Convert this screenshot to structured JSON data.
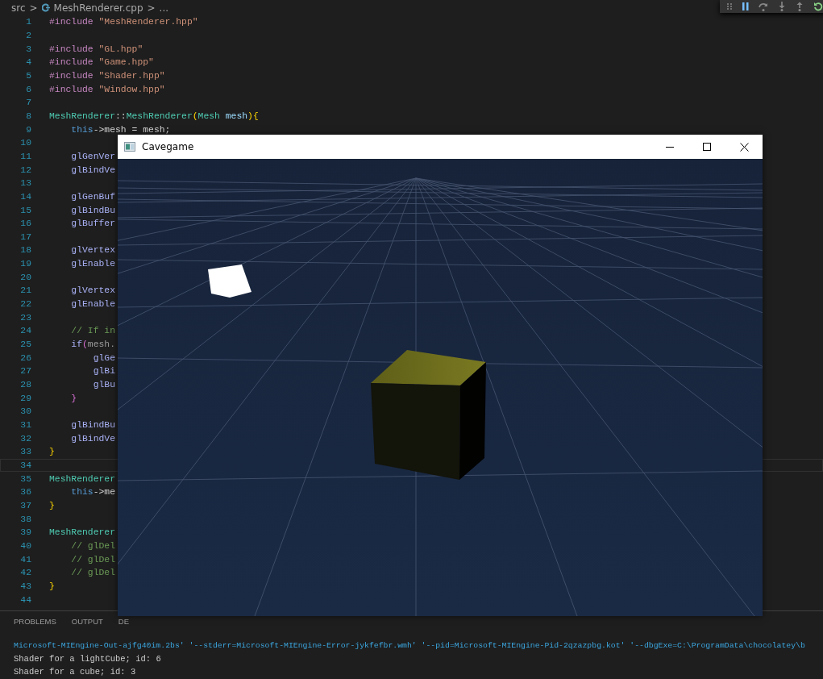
{
  "breadcrumb": {
    "folder": "src",
    "separator_1": ">",
    "file": "MeshRenderer.cpp",
    "separator_2": ">",
    "more": "..."
  },
  "debug_toolbar": {
    "buttons": [
      {
        "kind": "grip"
      },
      {
        "kind": "pause"
      },
      {
        "kind": "step-over"
      },
      {
        "kind": "step-into"
      },
      {
        "kind": "step-out"
      },
      {
        "kind": "restart"
      }
    ]
  },
  "editor": {
    "lines": [
      {
        "number": "1",
        "current": false,
        "tokens": [
          {
            "kind": "directive",
            "text": "#include "
          },
          {
            "kind": "string",
            "text": "\"MeshRenderer.hpp\""
          }
        ]
      },
      {
        "number": "2",
        "current": false
      },
      {
        "number": "3",
        "current": false,
        "tokens": [
          {
            "kind": "directive",
            "text": "#include "
          },
          {
            "kind": "string",
            "text": "\"GL.hpp\""
          }
        ]
      },
      {
        "number": "4",
        "current": false,
        "tokens": [
          {
            "kind": "directive",
            "text": "#include "
          },
          {
            "kind": "string",
            "text": "\"Game.hpp\""
          }
        ]
      },
      {
        "number": "5",
        "current": false,
        "tokens": [
          {
            "kind": "directive",
            "text": "#include "
          },
          {
            "kind": "string",
            "text": "\"Shader.hpp\""
          }
        ]
      },
      {
        "number": "6",
        "current": false,
        "tokens": [
          {
            "kind": "directive",
            "text": "#include "
          },
          {
            "kind": "string",
            "text": "\"Window.hpp\""
          }
        ]
      },
      {
        "number": "7",
        "current": false
      },
      {
        "number": "8",
        "current": false,
        "tokens": [
          {
            "kind": "type",
            "text": "MeshRenderer"
          },
          {
            "kind": "plain",
            "text": "::"
          },
          {
            "kind": "type",
            "text": "MeshRenderer"
          },
          {
            "kind": "bracket",
            "text": "("
          },
          {
            "kind": "type",
            "text": "Mesh"
          },
          {
            "kind": "variable",
            "text": " mesh"
          },
          {
            "kind": "bracket",
            "text": ")"
          },
          {
            "kind": "bracket",
            "text": "{"
          }
        ]
      },
      {
        "number": "9",
        "current": false,
        "tokens": [
          {
            "kind": "keyword",
            "text": "    this"
          },
          {
            "kind": "plain",
            "text": "->mesh = mesh;"
          }
        ]
      },
      {
        "number": "10",
        "current": false
      },
      {
        "number": "11",
        "current": false,
        "tokens": [
          {
            "kind": "function",
            "text": "    glGenVer"
          }
        ]
      },
      {
        "number": "12",
        "current": false,
        "tokens": [
          {
            "kind": "function",
            "text": "    glBindVe"
          }
        ]
      },
      {
        "number": "13",
        "current": false
      },
      {
        "number": "14",
        "current": false,
        "tokens": [
          {
            "kind": "function",
            "text": "    glGenBuf"
          }
        ]
      },
      {
        "number": "15",
        "current": false,
        "tokens": [
          {
            "kind": "function",
            "text": "    glBindBu"
          }
        ]
      },
      {
        "number": "16",
        "current": false,
        "tokens": [
          {
            "kind": "function",
            "text": "    glBuffer"
          }
        ]
      },
      {
        "number": "17",
        "current": false
      },
      {
        "number": "18",
        "current": false,
        "tokens": [
          {
            "kind": "function",
            "text": "    glVertex"
          }
        ]
      },
      {
        "number": "19",
        "current": false,
        "tokens": [
          {
            "kind": "function",
            "text": "    glEnable"
          }
        ]
      },
      {
        "number": "20",
        "current": false
      },
      {
        "number": "21",
        "current": false,
        "tokens": [
          {
            "kind": "function",
            "text": "    glVertex"
          }
        ]
      },
      {
        "number": "22",
        "current": false,
        "tokens": [
          {
            "kind": "function",
            "text": "    glEnable"
          }
        ]
      },
      {
        "number": "23",
        "current": false
      },
      {
        "number": "24",
        "current": false,
        "tokens": [
          {
            "kind": "comment",
            "text": "    // If in"
          }
        ]
      },
      {
        "number": "25",
        "current": false,
        "tokens": [
          {
            "kind": "function",
            "text": "    if"
          },
          {
            "kind": "bracket2",
            "text": "("
          },
          {
            "kind": "muted",
            "text": "mesh."
          }
        ]
      },
      {
        "number": "26",
        "current": false,
        "tokens": [
          {
            "kind": "function",
            "text": "        glGe"
          }
        ]
      },
      {
        "number": "27",
        "current": false,
        "tokens": [
          {
            "kind": "function",
            "text": "        glBi"
          }
        ]
      },
      {
        "number": "28",
        "current": false,
        "tokens": [
          {
            "kind": "function",
            "text": "        glBu"
          }
        ]
      },
      {
        "number": "29",
        "current": false,
        "tokens": [
          {
            "kind": "bracket2",
            "text": "    }"
          }
        ]
      },
      {
        "number": "30",
        "current": false
      },
      {
        "number": "31",
        "current": false,
        "tokens": [
          {
            "kind": "function",
            "text": "    glBindBu"
          }
        ]
      },
      {
        "number": "32",
        "current": false,
        "tokens": [
          {
            "kind": "function",
            "text": "    glBindVe"
          }
        ]
      },
      {
        "number": "33",
        "current": false,
        "tokens": [
          {
            "kind": "bracket",
            "text": "}"
          }
        ]
      },
      {
        "number": "34",
        "current": true
      },
      {
        "number": "35",
        "current": false,
        "tokens": [
          {
            "kind": "type",
            "text": "MeshRenderer"
          }
        ]
      },
      {
        "number": "36",
        "current": false,
        "tokens": [
          {
            "kind": "keyword",
            "text": "    this"
          },
          {
            "kind": "plain",
            "text": "->me"
          }
        ]
      },
      {
        "number": "37",
        "current": false,
        "tokens": [
          {
            "kind": "bracket",
            "text": "}"
          }
        ]
      },
      {
        "number": "38",
        "current": false
      },
      {
        "number": "39",
        "current": false,
        "tokens": [
          {
            "kind": "type",
            "text": "MeshRenderer"
          }
        ]
      },
      {
        "number": "40",
        "current": false,
        "tokens": [
          {
            "kind": "comment",
            "text": "    // glDel"
          }
        ]
      },
      {
        "number": "41",
        "current": false,
        "tokens": [
          {
            "kind": "comment",
            "text": "    // glDel"
          }
        ]
      },
      {
        "number": "42",
        "current": false,
        "tokens": [
          {
            "kind": "comment",
            "text": "    // glDel"
          }
        ]
      },
      {
        "number": "43",
        "current": false,
        "tokens": [
          {
            "kind": "bracket",
            "text": "}"
          }
        ]
      },
      {
        "number": "44",
        "current": false
      }
    ]
  },
  "panel": {
    "tabs": [
      "PROBLEMS",
      "OUTPUT",
      "DE"
    ],
    "output": [
      {
        "kind": "command",
        "text": "Microsoft-MIEngine-Out-ajfg40im.2bs' '--stderr=Microsoft-MIEngine-Error-jykfefbr.wmh' '--pid=Microsoft-MIEngine-Pid-2qzazpbg.kot' '--dbgExe=C:\\ProgramData\\chocolatey\\b"
      },
      {
        "kind": "log",
        "text": "Shader for a lightCube; id: 6"
      },
      {
        "kind": "log",
        "text": "Shader for a cube; id: 3"
      }
    ]
  },
  "game_window": {
    "title": "Cavegame",
    "controls": [
      {
        "kind": "minimize"
      },
      {
        "kind": "maximize"
      },
      {
        "kind": "close"
      }
    ]
  }
}
